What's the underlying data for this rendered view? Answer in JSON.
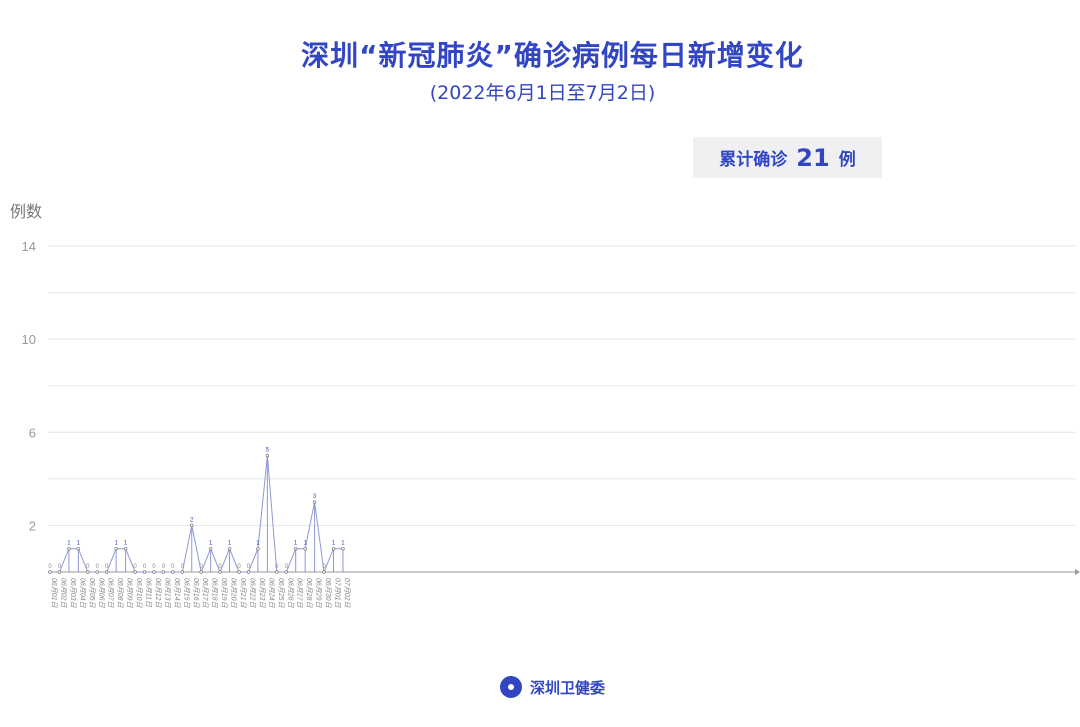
{
  "header": {
    "title": "深圳“新冠肺炎”确诊病例每日新增变化",
    "subtitle": "(2022年6月1日至7月2日)"
  },
  "total": {
    "prefix": "累计确诊",
    "value": "21",
    "suffix": "例"
  },
  "footer": {
    "org": "深圳卫健委",
    "logo_icon": "health-commission-logo-icon"
  },
  "colors": {
    "accent": "#3246c4",
    "line": "#8e98d6",
    "grid": "#e6e6e6"
  },
  "chart_data": {
    "type": "line",
    "ylabel": "例数",
    "xlabel": "",
    "ylim": [
      0,
      14
    ],
    "yticks": [
      2,
      6,
      10,
      14
    ],
    "grid": true,
    "categories": [
      "06月01日",
      "06月02日",
      "06月03日",
      "06月04日",
      "06月05日",
      "06月06日",
      "06月07日",
      "06月08日",
      "06月09日",
      "06月10日",
      "06月11日",
      "06月12日",
      "06月13日",
      "06月14日",
      "06月15日",
      "06月16日",
      "06月17日",
      "06月18日",
      "06月19日",
      "06月20日",
      "06月21日",
      "06月22日",
      "06月23日",
      "06月24日",
      "06月25日",
      "06月26日",
      "06月27日",
      "06月28日",
      "06月29日",
      "06月30日",
      "07月01日",
      "07月02日"
    ],
    "values": [
      0,
      0,
      1,
      1,
      0,
      0,
      0,
      1,
      1,
      0,
      0,
      0,
      0,
      0,
      0,
      2,
      0,
      1,
      0,
      1,
      0,
      0,
      1,
      5,
      0,
      0,
      1,
      1,
      3,
      0,
      1,
      1
    ]
  }
}
